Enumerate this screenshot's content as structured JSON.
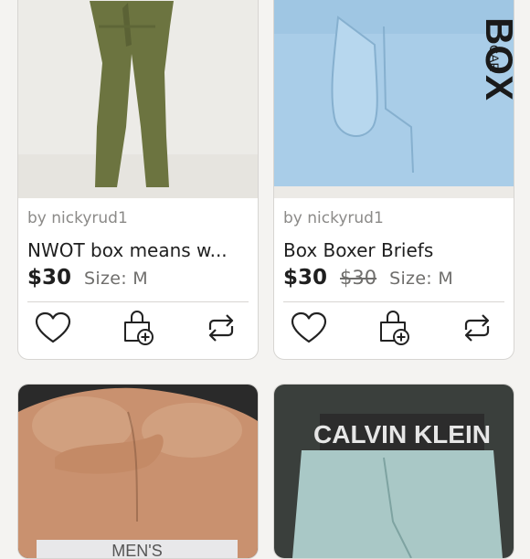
{
  "listings": [
    {
      "seller": "by nickyrud1",
      "title": "NWOT box means w...",
      "price": "$30",
      "original_price": "",
      "size": "Size: M"
    },
    {
      "seller": "by nickyrud1",
      "title": "Box Boxer Briefs",
      "price": "$30",
      "original_price": "$30",
      "size": "Size: M"
    },
    {
      "seller": "",
      "title": "",
      "price": "",
      "size": ""
    },
    {
      "seller": "",
      "title": "",
      "price": "",
      "size": ""
    }
  ],
  "photo_text": {
    "box_logo": "BOX",
    "box_logo_small": "CAR",
    "calvin_band": "CALVIN KLEIN",
    "mens_band": "MEN'S"
  },
  "icons": [
    "heart-icon",
    "bundle-add-icon",
    "share-icon"
  ],
  "colors": {
    "background": "#f4f3f1",
    "card_border": "#d7d5d2",
    "muted_text": "#8b8a88"
  }
}
